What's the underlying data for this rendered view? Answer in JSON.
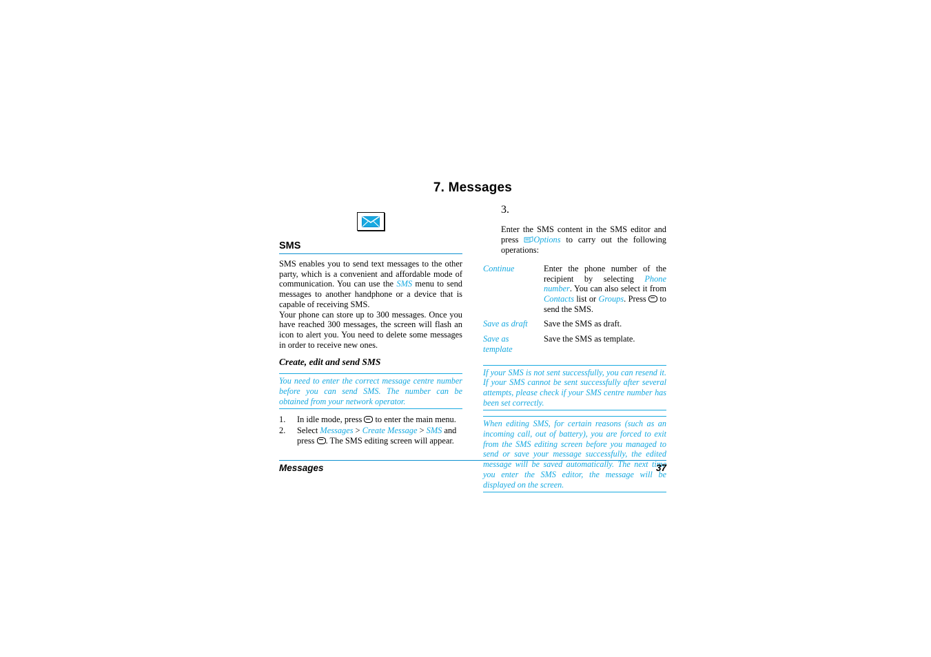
{
  "document": {
    "chapter_title": "7. Messages",
    "header_icon": "envelope-icon"
  },
  "left_column": {
    "section_title": "SMS",
    "paragraph_1_a": "SMS enables you to send text messages to the other party, which is a convenient and affordable mode of communication. You can use the ",
    "paragraph_1_link": "SMS",
    "paragraph_1_b": " menu to send messages to another handphone or a device that is capable of receiving SMS.",
    "paragraph_2": "Your phone can store up to 300 messages. Once you have reached 300 messages, the screen will flash an icon to alert you. You need to delete some messages in order to receive new ones.",
    "subsection_title": "Create, edit and send SMS",
    "note": "You need to enter the correct message centre number before you can send SMS. The number can be obtained from your network operator.",
    "steps": [
      {
        "number": "1.",
        "text_a": "In idle mode, press ",
        "key": "ok-key-icon",
        "text_b": " to enter the main menu."
      },
      {
        "number": "2.",
        "text_a": "Select ",
        "link_1": "Messages",
        "sep_1": " > ",
        "link_2": "Create Message",
        "sep_2": " > ",
        "link_3": "SMS",
        "text_b": " and press ",
        "key": "ok-key-icon",
        "text_c": ". The SMS editing screen will appear."
      }
    ]
  },
  "right_column": {
    "step": {
      "number": "3.",
      "text_a": "Enter the SMS content in the SMS editor and press ",
      "options_icon": "options-softkey-icon",
      "options_label": "Options",
      "text_b": " to carry out the following operations:"
    },
    "options_table": [
      {
        "label": "Continue",
        "desc_a": "Enter the phone number of the recipient by selecting ",
        "link_1": "Phone number",
        "desc_b": ". You can also select it from ",
        "link_2": "Contacts",
        "desc_c": " list or ",
        "link_3": "Groups",
        "desc_d": ". Press ",
        "key": "ok-key-icon",
        "desc_e": " to send the SMS."
      },
      {
        "label": "Save as draft",
        "desc_a": "Save the SMS as draft."
      },
      {
        "label": "Save as template",
        "desc_a": "Save the SMS as template."
      }
    ],
    "note_1": "If your SMS is not sent successfully, you can resend it. If your SMS cannot be sent successfully after several attempts, please check if your SMS centre number has been set correctly.",
    "note_2": "When editing SMS, for certain reasons (such as an incoming call, out of battery), you are forced to exit from the SMS editing screen before you managed to send or save your message successfully, the edited message will be saved automatically. The next time you enter the SMS editor, the message will be displayed on the screen."
  },
  "footer": {
    "title": "Messages",
    "page_number": "37"
  },
  "colors": {
    "accent_cyan": "#17a9e0",
    "rule_blue": "#0b8fd1"
  }
}
